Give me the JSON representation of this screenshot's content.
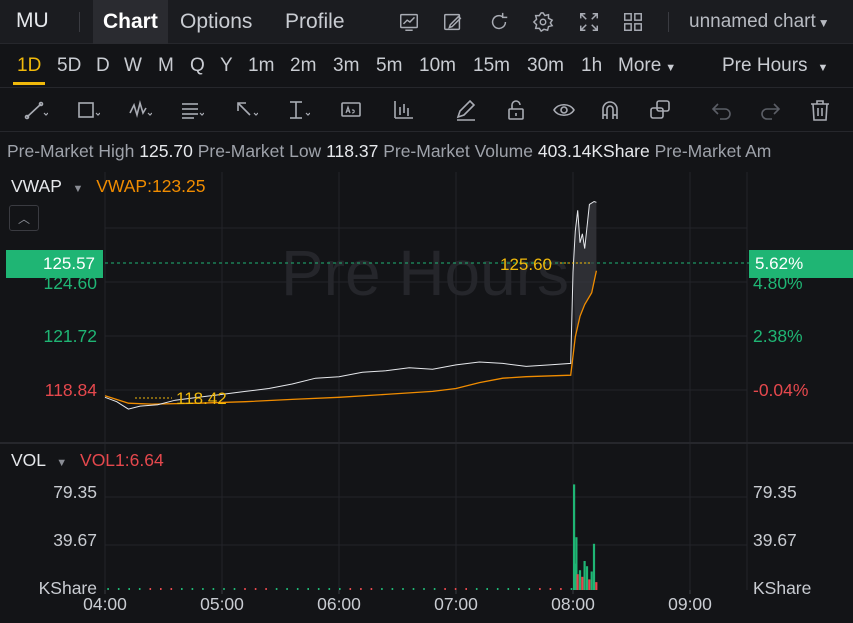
{
  "header": {
    "ticker": "MU",
    "tabs": [
      {
        "label": "Chart",
        "active": true
      },
      {
        "label": "Options",
        "active": false
      },
      {
        "label": "Profile",
        "active": false
      }
    ],
    "chart_name": "unnamed chart"
  },
  "timeframes": {
    "items": [
      "1D",
      "5D",
      "D",
      "W",
      "M",
      "Q",
      "Y",
      "1m",
      "2m",
      "3m",
      "5m",
      "10m",
      "15m",
      "30m",
      "1h"
    ],
    "active": "1D",
    "more_label": "More",
    "session_label": "Pre Hours"
  },
  "info_strip": {
    "high_label": "Pre-Market High",
    "high_value": "125.70",
    "low_label": "Pre-Market Low",
    "low_value": "118.37",
    "volume_label": "Pre-Market Volume",
    "volume_value": "403.14KShare",
    "amount_label": "Pre-Market Am"
  },
  "price_panel": {
    "indicator_name": "VWAP",
    "indicator_value": "VWAP:123.25",
    "watermark": "Pre Hours",
    "current_price": "125.57",
    "current_pct": "5.62%",
    "high_marker": "125.60",
    "low_marker": "118.42",
    "left_axis": [
      "124.60",
      "121.72",
      "118.84"
    ],
    "right_axis": [
      "4.80%",
      "2.38%",
      "-0.04%"
    ]
  },
  "volume_panel": {
    "indicator_name": "VOL",
    "indicator_value": "VOL1:6.64",
    "left_axis": [
      "79.35",
      "39.67",
      "KShare"
    ],
    "right_axis": [
      "79.35",
      "39.67",
      "KShare"
    ]
  },
  "colors": {
    "up": "#1fb574",
    "down": "#e5484d",
    "vwap": "#f08c00",
    "price_line": "#e6e8ec",
    "accent": "#f0b90b"
  },
  "chart_data": {
    "type": "line",
    "x_ticks": [
      "04:00",
      "05:00",
      "06:00",
      "07:00",
      "08:00",
      "09:00"
    ],
    "ylim": [
      117.5,
      126.6
    ],
    "price": [
      [
        4.0,
        118.95
      ],
      [
        4.1,
        118.8
      ],
      [
        4.2,
        118.55
      ],
      [
        4.3,
        118.65
      ],
      [
        4.45,
        118.7
      ],
      [
        4.6,
        118.85
      ],
      [
        4.8,
        118.95
      ],
      [
        5.0,
        119.05
      ],
      [
        5.2,
        119.15
      ],
      [
        5.4,
        119.25
      ],
      [
        5.6,
        119.4
      ],
      [
        5.8,
        119.6
      ],
      [
        6.0,
        119.65
      ],
      [
        6.2,
        119.8
      ],
      [
        6.4,
        119.85
      ],
      [
        6.6,
        119.95
      ],
      [
        6.8,
        119.9
      ],
      [
        7.0,
        120.05
      ],
      [
        7.2,
        120.15
      ],
      [
        7.4,
        120.1
      ],
      [
        7.6,
        120.0
      ],
      [
        7.8,
        120.05
      ],
      [
        7.98,
        120.1
      ],
      [
        8.0,
        123.2
      ],
      [
        8.02,
        124.6
      ],
      [
        8.04,
        125.3
      ],
      [
        8.06,
        124.2
      ],
      [
        8.08,
        124.5
      ],
      [
        8.1,
        124.0
      ],
      [
        8.14,
        125.5
      ],
      [
        8.18,
        125.6
      ],
      [
        8.2,
        125.57
      ]
    ],
    "vwap": [
      [
        4.0,
        119.0
      ],
      [
        4.2,
        118.75
      ],
      [
        4.4,
        118.72
      ],
      [
        4.8,
        118.75
      ],
      [
        5.2,
        118.8
      ],
      [
        5.6,
        118.88
      ],
      [
        6.0,
        118.95
      ],
      [
        6.4,
        119.05
      ],
      [
        6.8,
        119.15
      ],
      [
        7.0,
        119.25
      ],
      [
        7.2,
        119.45
      ],
      [
        7.4,
        119.6
      ],
      [
        7.6,
        119.65
      ],
      [
        7.98,
        119.7
      ],
      [
        8.02,
        121.0
      ],
      [
        8.06,
        121.7
      ],
      [
        8.1,
        122.1
      ],
      [
        8.16,
        122.5
      ],
      [
        8.2,
        123.25
      ]
    ],
    "volume": [
      [
        8.0,
        80,
        "up"
      ],
      [
        8.01,
        20,
        "up"
      ],
      [
        8.02,
        40,
        "up"
      ],
      [
        8.03,
        12,
        "down"
      ],
      [
        8.05,
        15,
        "up"
      ],
      [
        8.07,
        10,
        "down"
      ],
      [
        8.09,
        22,
        "up"
      ],
      [
        8.11,
        18,
        "up"
      ],
      [
        8.13,
        8,
        "down"
      ],
      [
        8.15,
        14,
        "up"
      ],
      [
        8.17,
        35,
        "up"
      ],
      [
        8.19,
        6,
        "down"
      ]
    ],
    "ylim_volume": [
      0,
      100
    ]
  }
}
